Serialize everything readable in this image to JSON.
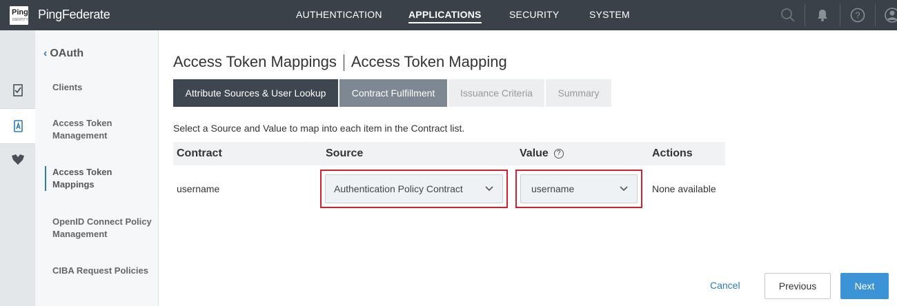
{
  "header": {
    "logo_text": "Ping",
    "logo_subtext": "IDENTITY",
    "brand": "PingFederate",
    "nav": [
      {
        "label": "AUTHENTICATION"
      },
      {
        "label": "APPLICATIONS"
      },
      {
        "label": "SECURITY"
      },
      {
        "label": "SYSTEM"
      }
    ],
    "active_nav": "APPLICATIONS"
  },
  "subnav": {
    "back_label": "OAuth",
    "items": [
      {
        "label": "Clients"
      },
      {
        "label": "Access Token Management"
      },
      {
        "label": "Access Token Mappings"
      },
      {
        "label": "OpenID Connect Policy Management"
      },
      {
        "label": "CIBA Request Policies"
      }
    ],
    "active_item": "Access Token Mappings"
  },
  "main": {
    "breadcrumb_parent": "Access Token Mappings",
    "breadcrumb_current": "Access Token Mapping",
    "tabs": [
      {
        "label": "Attribute Sources & User Lookup"
      },
      {
        "label": "Contract Fulfillment"
      },
      {
        "label": "Issuance Criteria"
      },
      {
        "label": "Summary"
      }
    ],
    "instructions": "Select a Source and Value to map into each item in the Contract list.",
    "table": {
      "headers": [
        "Contract",
        "Source",
        "Value",
        "Actions"
      ],
      "rows": [
        {
          "contract": "username",
          "source": "Authentication Policy Contract",
          "value": "username",
          "actions": "None available"
        }
      ]
    },
    "buttons": {
      "cancel": "Cancel",
      "previous": "Previous",
      "next": "Next"
    }
  },
  "colors": {
    "topbar": "#3b4148",
    "accent": "#3c94d6",
    "highlight": "#d0202f"
  }
}
